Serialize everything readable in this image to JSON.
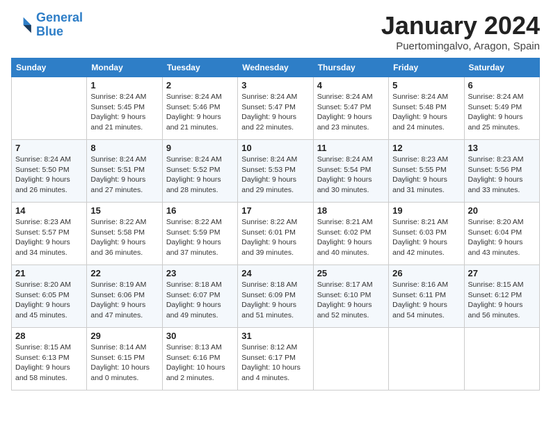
{
  "header": {
    "logo_line1": "General",
    "logo_line2": "Blue",
    "month_title": "January 2024",
    "location": "Puertomingalvo, Aragon, Spain"
  },
  "weekdays": [
    "Sunday",
    "Monday",
    "Tuesday",
    "Wednesday",
    "Thursday",
    "Friday",
    "Saturday"
  ],
  "weeks": [
    [
      {
        "day": "",
        "sunrise": "",
        "sunset": "",
        "daylight": ""
      },
      {
        "day": "1",
        "sunrise": "Sunrise: 8:24 AM",
        "sunset": "Sunset: 5:45 PM",
        "daylight": "Daylight: 9 hours and 21 minutes."
      },
      {
        "day": "2",
        "sunrise": "Sunrise: 8:24 AM",
        "sunset": "Sunset: 5:46 PM",
        "daylight": "Daylight: 9 hours and 21 minutes."
      },
      {
        "day": "3",
        "sunrise": "Sunrise: 8:24 AM",
        "sunset": "Sunset: 5:47 PM",
        "daylight": "Daylight: 9 hours and 22 minutes."
      },
      {
        "day": "4",
        "sunrise": "Sunrise: 8:24 AM",
        "sunset": "Sunset: 5:47 PM",
        "daylight": "Daylight: 9 hours and 23 minutes."
      },
      {
        "day": "5",
        "sunrise": "Sunrise: 8:24 AM",
        "sunset": "Sunset: 5:48 PM",
        "daylight": "Daylight: 9 hours and 24 minutes."
      },
      {
        "day": "6",
        "sunrise": "Sunrise: 8:24 AM",
        "sunset": "Sunset: 5:49 PM",
        "daylight": "Daylight: 9 hours and 25 minutes."
      }
    ],
    [
      {
        "day": "7",
        "sunrise": "Sunrise: 8:24 AM",
        "sunset": "Sunset: 5:50 PM",
        "daylight": "Daylight: 9 hours and 26 minutes."
      },
      {
        "day": "8",
        "sunrise": "Sunrise: 8:24 AM",
        "sunset": "Sunset: 5:51 PM",
        "daylight": "Daylight: 9 hours and 27 minutes."
      },
      {
        "day": "9",
        "sunrise": "Sunrise: 8:24 AM",
        "sunset": "Sunset: 5:52 PM",
        "daylight": "Daylight: 9 hours and 28 minutes."
      },
      {
        "day": "10",
        "sunrise": "Sunrise: 8:24 AM",
        "sunset": "Sunset: 5:53 PM",
        "daylight": "Daylight: 9 hours and 29 minutes."
      },
      {
        "day": "11",
        "sunrise": "Sunrise: 8:24 AM",
        "sunset": "Sunset: 5:54 PM",
        "daylight": "Daylight: 9 hours and 30 minutes."
      },
      {
        "day": "12",
        "sunrise": "Sunrise: 8:23 AM",
        "sunset": "Sunset: 5:55 PM",
        "daylight": "Daylight: 9 hours and 31 minutes."
      },
      {
        "day": "13",
        "sunrise": "Sunrise: 8:23 AM",
        "sunset": "Sunset: 5:56 PM",
        "daylight": "Daylight: 9 hours and 33 minutes."
      }
    ],
    [
      {
        "day": "14",
        "sunrise": "Sunrise: 8:23 AM",
        "sunset": "Sunset: 5:57 PM",
        "daylight": "Daylight: 9 hours and 34 minutes."
      },
      {
        "day": "15",
        "sunrise": "Sunrise: 8:22 AM",
        "sunset": "Sunset: 5:58 PM",
        "daylight": "Daylight: 9 hours and 36 minutes."
      },
      {
        "day": "16",
        "sunrise": "Sunrise: 8:22 AM",
        "sunset": "Sunset: 5:59 PM",
        "daylight": "Daylight: 9 hours and 37 minutes."
      },
      {
        "day": "17",
        "sunrise": "Sunrise: 8:22 AM",
        "sunset": "Sunset: 6:01 PM",
        "daylight": "Daylight: 9 hours and 39 minutes."
      },
      {
        "day": "18",
        "sunrise": "Sunrise: 8:21 AM",
        "sunset": "Sunset: 6:02 PM",
        "daylight": "Daylight: 9 hours and 40 minutes."
      },
      {
        "day": "19",
        "sunrise": "Sunrise: 8:21 AM",
        "sunset": "Sunset: 6:03 PM",
        "daylight": "Daylight: 9 hours and 42 minutes."
      },
      {
        "day": "20",
        "sunrise": "Sunrise: 8:20 AM",
        "sunset": "Sunset: 6:04 PM",
        "daylight": "Daylight: 9 hours and 43 minutes."
      }
    ],
    [
      {
        "day": "21",
        "sunrise": "Sunrise: 8:20 AM",
        "sunset": "Sunset: 6:05 PM",
        "daylight": "Daylight: 9 hours and 45 minutes."
      },
      {
        "day": "22",
        "sunrise": "Sunrise: 8:19 AM",
        "sunset": "Sunset: 6:06 PM",
        "daylight": "Daylight: 9 hours and 47 minutes."
      },
      {
        "day": "23",
        "sunrise": "Sunrise: 8:18 AM",
        "sunset": "Sunset: 6:07 PM",
        "daylight": "Daylight: 9 hours and 49 minutes."
      },
      {
        "day": "24",
        "sunrise": "Sunrise: 8:18 AM",
        "sunset": "Sunset: 6:09 PM",
        "daylight": "Daylight: 9 hours and 51 minutes."
      },
      {
        "day": "25",
        "sunrise": "Sunrise: 8:17 AM",
        "sunset": "Sunset: 6:10 PM",
        "daylight": "Daylight: 9 hours and 52 minutes."
      },
      {
        "day": "26",
        "sunrise": "Sunrise: 8:16 AM",
        "sunset": "Sunset: 6:11 PM",
        "daylight": "Daylight: 9 hours and 54 minutes."
      },
      {
        "day": "27",
        "sunrise": "Sunrise: 8:15 AM",
        "sunset": "Sunset: 6:12 PM",
        "daylight": "Daylight: 9 hours and 56 minutes."
      }
    ],
    [
      {
        "day": "28",
        "sunrise": "Sunrise: 8:15 AM",
        "sunset": "Sunset: 6:13 PM",
        "daylight": "Daylight: 9 hours and 58 minutes."
      },
      {
        "day": "29",
        "sunrise": "Sunrise: 8:14 AM",
        "sunset": "Sunset: 6:15 PM",
        "daylight": "Daylight: 10 hours and 0 minutes."
      },
      {
        "day": "30",
        "sunrise": "Sunrise: 8:13 AM",
        "sunset": "Sunset: 6:16 PM",
        "daylight": "Daylight: 10 hours and 2 minutes."
      },
      {
        "day": "31",
        "sunrise": "Sunrise: 8:12 AM",
        "sunset": "Sunset: 6:17 PM",
        "daylight": "Daylight: 10 hours and 4 minutes."
      },
      {
        "day": "",
        "sunrise": "",
        "sunset": "",
        "daylight": ""
      },
      {
        "day": "",
        "sunrise": "",
        "sunset": "",
        "daylight": ""
      },
      {
        "day": "",
        "sunrise": "",
        "sunset": "",
        "daylight": ""
      }
    ]
  ]
}
